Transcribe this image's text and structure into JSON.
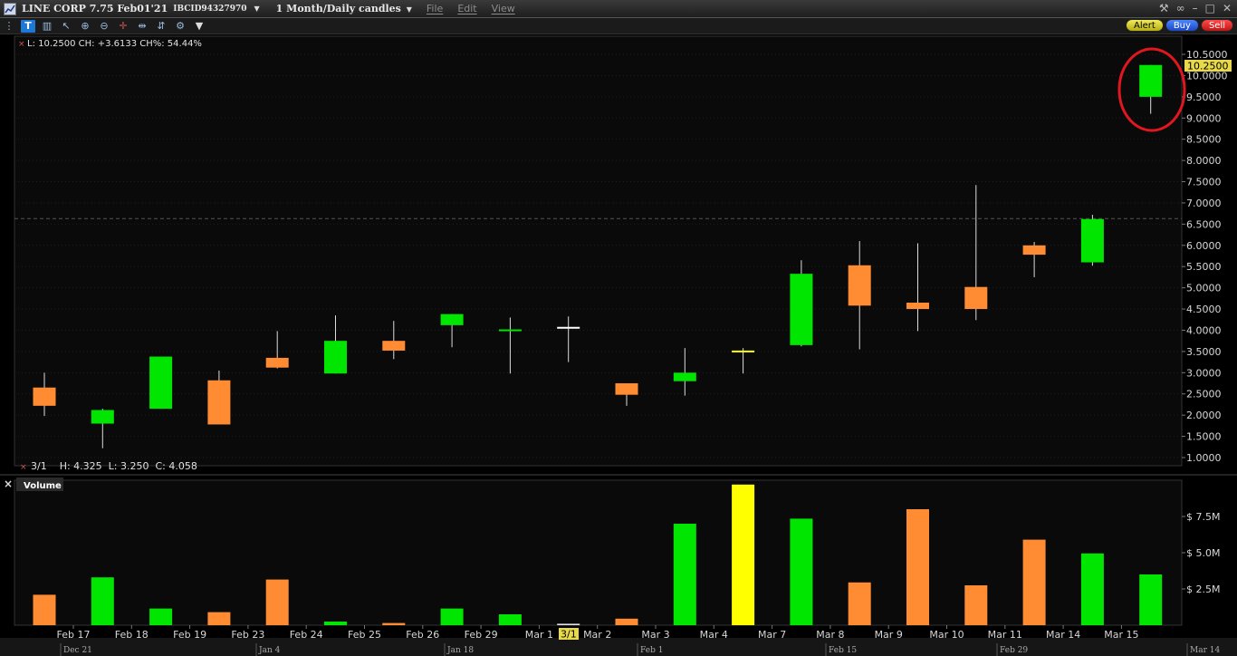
{
  "window": {
    "title": "LINE CORP 7.75 Feb01'21",
    "conid": "IBCID94327970",
    "period": "1 Month/Daily candles",
    "menu": [
      "File",
      "Edit",
      "View"
    ]
  },
  "actions": {
    "alert": "Alert",
    "buy": "Buy",
    "sell": "Sell"
  },
  "readout_top": "L: 10.2500 CH: +3.6133 CH%: 54.44%",
  "readout_bottom": "3/1    H: 4.325  L: 3.250  C: 4.058",
  "volume_panel": {
    "label": "Volume"
  },
  "last_price": "10.2500",
  "cursor_date": "3/1",
  "colors": {
    "up": "#00e600",
    "down": "#ff8c32",
    "doji": "#ffff00",
    "highlight": "#e0171f"
  },
  "chart_data": {
    "type": "candlestick",
    "categories": [
      "Feb 17",
      "Feb 18",
      "Feb 19",
      "Feb 23",
      "Feb 24",
      "Feb 25",
      "Feb 26",
      "Feb 29",
      "Mar 1",
      "Mar 2",
      "Mar 3",
      "Mar 4",
      "Mar 7",
      "Mar 8",
      "Mar 9",
      "Mar 10",
      "Mar 11",
      "Mar 14",
      "Mar 15"
    ],
    "candles": [
      {
        "open": 2.65,
        "high": 3.0,
        "low": 1.98,
        "close": 2.22,
        "dir": "down"
      },
      {
        "open": 1.8,
        "high": 2.15,
        "low": 1.22,
        "close": 2.12,
        "dir": "up"
      },
      {
        "open": 2.15,
        "high": 3.38,
        "low": 2.15,
        "close": 3.38,
        "dir": "up"
      },
      {
        "open": 2.82,
        "high": 3.05,
        "low": 1.78,
        "close": 1.78,
        "dir": "down"
      },
      {
        "open": 3.35,
        "high": 3.98,
        "low": 3.1,
        "close": 3.12,
        "dir": "down"
      },
      {
        "open": 2.98,
        "high": 4.35,
        "low": 2.98,
        "close": 3.75,
        "dir": "up"
      },
      {
        "open": 3.75,
        "high": 4.22,
        "low": 3.32,
        "close": 3.52,
        "dir": "down"
      },
      {
        "open": 4.12,
        "high": 4.38,
        "low": 3.6,
        "close": 4.38,
        "dir": "up"
      },
      {
        "open": 4.0,
        "high": 4.3,
        "low": 2.98,
        "close": 4.02,
        "dir": "up"
      },
      {
        "open": 4.08,
        "high": 4.325,
        "low": 3.25,
        "close": 4.058,
        "dir": "doji-white"
      },
      {
        "open": 2.75,
        "high": 2.75,
        "low": 2.22,
        "close": 2.48,
        "dir": "down"
      },
      {
        "open": 2.8,
        "high": 3.58,
        "low": 2.46,
        "close": 3.0,
        "dir": "up"
      },
      {
        "open": 3.48,
        "high": 3.58,
        "low": 2.98,
        "close": 3.5,
        "dir": "doji"
      },
      {
        "open": 3.65,
        "high": 5.65,
        "low": 3.62,
        "close": 5.33,
        "dir": "up"
      },
      {
        "open": 5.53,
        "high": 6.1,
        "low": 3.55,
        "close": 4.58,
        "dir": "down"
      },
      {
        "open": 4.65,
        "high": 6.05,
        "low": 3.98,
        "close": 4.5,
        "dir": "down"
      },
      {
        "open": 5.02,
        "high": 7.42,
        "low": 4.24,
        "close": 4.5,
        "dir": "down"
      },
      {
        "open": 6.0,
        "high": 6.08,
        "low": 5.25,
        "close": 5.78,
        "dir": "down"
      },
      {
        "open": 5.6,
        "high": 6.72,
        "low": 5.52,
        "close": 6.62,
        "dir": "up"
      },
      {
        "open": 9.5,
        "high": 10.25,
        "low": 9.1,
        "close": 10.25,
        "dir": "up"
      }
    ],
    "volume": [
      2.1,
      3.3,
      1.15,
      0.9,
      3.15,
      0.25,
      0.15,
      1.15,
      0.75,
      0.1,
      0.45,
      7.0,
      9.7,
      7.35,
      2.95,
      8.0,
      2.75,
      5.9,
      4.95,
      3.5
    ],
    "volume_dir": [
      "down",
      "up",
      "up",
      "down",
      "down",
      "up",
      "down",
      "up",
      "up",
      "doji-white",
      "down",
      "up",
      "doji",
      "up",
      "down",
      "down",
      "down",
      "down",
      "up",
      "up"
    ],
    "y_ticks": [
      "10.5000",
      "10.0000",
      "9.5000",
      "9.0000",
      "8.5000",
      "8.0000",
      "7.5000",
      "7.0000",
      "6.5000",
      "6.0000",
      "5.5000",
      "5.0000",
      "4.5000",
      "4.0000",
      "3.5000",
      "3.0000",
      "2.5000",
      "2.0000",
      "1.5000",
      "1.0000"
    ],
    "y_range": [
      1.0,
      10.5
    ],
    "vol_ticks": [
      "$ 7.5M",
      "$ 5.0M",
      "$ 2.5M"
    ],
    "vol_range": [
      0,
      10
    ],
    "dashed_level": 6.63,
    "bottom_axis": [
      "Dec 21",
      "Jan 4",
      "Jan 18",
      "Feb 1",
      "Feb 15",
      "Feb 29",
      "Mar 14"
    ]
  }
}
